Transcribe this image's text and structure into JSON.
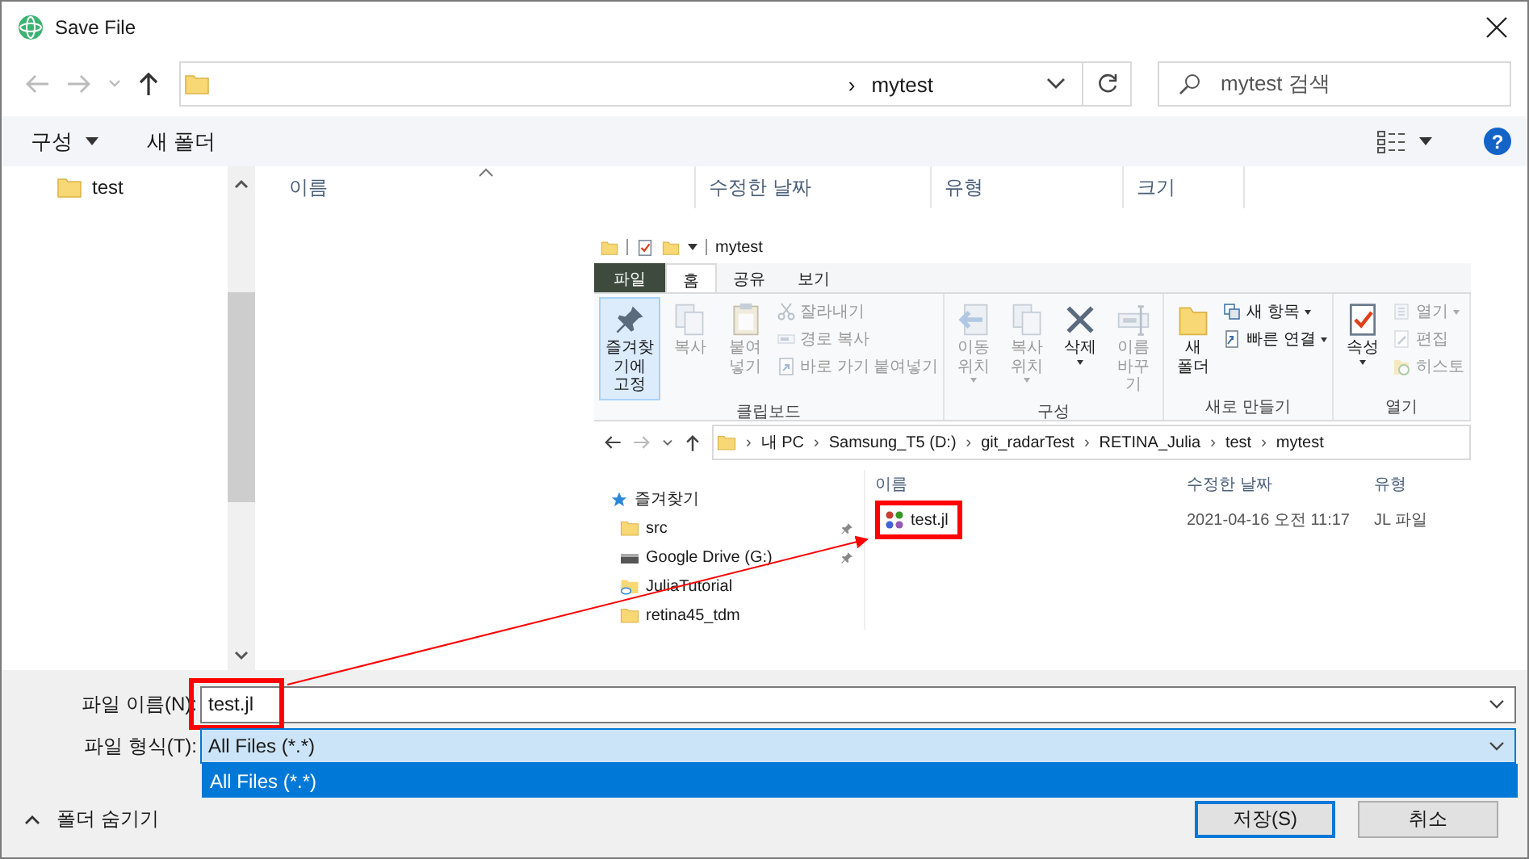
{
  "window": {
    "title": "Save File"
  },
  "address_bar": {
    "separator": "›",
    "path": "mytest"
  },
  "search": {
    "placeholder": "mytest 검색"
  },
  "toolbar": {
    "organize": "구성",
    "new_folder": "새 폴더",
    "help": "?"
  },
  "nav_pane": {
    "items": [
      "test"
    ]
  },
  "columns": [
    "이름",
    "수정한 날짜",
    "유형",
    "크기"
  ],
  "embedded_screenshot": {
    "title": "mytest",
    "tabs": [
      {
        "label": "파일",
        "kind": "file",
        "selected": false
      },
      {
        "label": "홈",
        "kind": "tab",
        "selected": true
      },
      {
        "label": "공유",
        "kind": "tab",
        "selected": false
      },
      {
        "label": "보기",
        "kind": "tab",
        "selected": false
      }
    ],
    "ribbon_groups": [
      {
        "label": "클립보드",
        "items": [
          {
            "kind": "large",
            "label": "즐겨찾기에\n고정",
            "disabled": false,
            "menu": false,
            "highlighted": true
          },
          {
            "kind": "large",
            "label": "복사",
            "disabled": true,
            "menu": false,
            "highlighted": false
          },
          {
            "kind": "large",
            "label": "붙여넣기",
            "disabled": true,
            "menu": false,
            "highlighted": false
          },
          {
            "kind": "small",
            "label": "잘라내기",
            "disabled": true,
            "menu": false
          },
          {
            "kind": "small",
            "label": "경로 복사",
            "disabled": true,
            "menu": false
          },
          {
            "kind": "small",
            "label": "바로 가기 붙여넣기",
            "disabled": true,
            "menu": false
          }
        ]
      },
      {
        "label": "구성",
        "items": [
          {
            "kind": "large",
            "label": "이동\n위치",
            "disabled": true,
            "menu": true,
            "highlighted": false
          },
          {
            "kind": "large",
            "label": "복사\n위치",
            "disabled": true,
            "menu": true,
            "highlighted": false
          },
          {
            "kind": "large",
            "label": "삭제",
            "disabled": false,
            "menu": true,
            "highlighted": false
          },
          {
            "kind": "large",
            "label": "이름\n바꾸기",
            "disabled": true,
            "menu": false,
            "highlighted": false
          }
        ]
      },
      {
        "label": "새로 만들기",
        "items": [
          {
            "kind": "large",
            "label": "새\n폴더",
            "disabled": false,
            "menu": false,
            "highlighted": false
          },
          {
            "kind": "small",
            "label": "새 항목",
            "disabled": false,
            "menu": true
          },
          {
            "kind": "small",
            "label": "빠른 연결",
            "disabled": false,
            "menu": true
          }
        ]
      },
      {
        "label": "열기",
        "items": [
          {
            "kind": "large",
            "label": "속성",
            "disabled": false,
            "menu": true,
            "highlighted": false
          },
          {
            "kind": "small",
            "label": "열기",
            "disabled": true,
            "menu": true
          },
          {
            "kind": "small",
            "label": "편집",
            "disabled": true,
            "menu": false
          },
          {
            "kind": "small",
            "label": "히스토",
            "disabled": true,
            "menu": false
          }
        ]
      }
    ],
    "separator": "›",
    "path": [
      "내 PC",
      "Samsung_T5 (D:)",
      "git_radarTest",
      "RETINA_Julia",
      "test",
      "mytest"
    ],
    "nav_header": "즐겨찾기",
    "nav_items": [
      {
        "label": "src",
        "kind": "folder",
        "pinned": true
      },
      {
        "label": "Google Drive (G:)",
        "kind": "drive",
        "pinned": true
      },
      {
        "label": "JuliaTutorial",
        "kind": "cloud-folder",
        "pinned": false
      },
      {
        "label": "retina45_tdm",
        "kind": "folder",
        "pinned": false
      }
    ],
    "columns": [
      "이름",
      "수정한 날짜",
      "유형"
    ],
    "files": [
      {
        "name": "test.jl",
        "modified": "2021-04-16 오전 11:17",
        "type": "JL 파일",
        "highlighted": true
      }
    ]
  },
  "file_name": {
    "label": "파일 이름(N):",
    "value": "test.jl",
    "highlighted": true
  },
  "file_type": {
    "label": "파일 형식(T):",
    "value": "All Files (*.*)",
    "options": [
      {
        "label": "All Files (*.*)",
        "selected": true
      }
    ]
  },
  "hide_folders": "폴더 숨기기",
  "buttons": [
    {
      "label": "저장(S)",
      "default": true
    },
    {
      "label": "취소",
      "default": false
    }
  ]
}
